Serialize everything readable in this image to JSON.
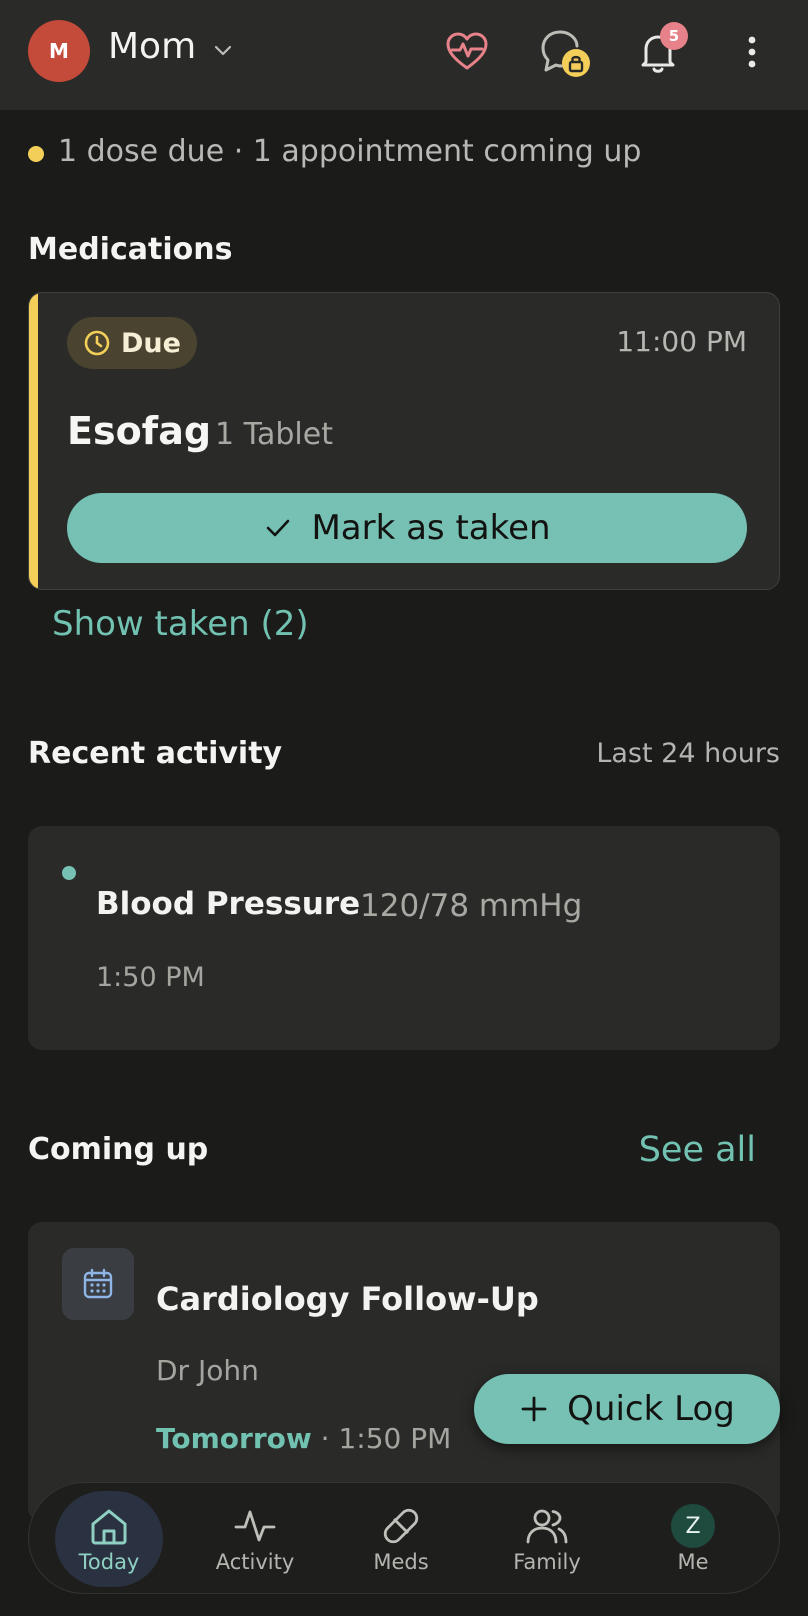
{
  "header": {
    "avatar_initial": "M",
    "profile_name": "Mom",
    "notifications_count": "5",
    "icons": [
      "heart-pulse-icon",
      "chat-lock-icon",
      "bell-icon",
      "more-vertical-icon"
    ]
  },
  "summary": {
    "text": "1 dose due · 1 appointment coming up"
  },
  "medications": {
    "title": "Medications",
    "card": {
      "status": "Due",
      "time": "11:00 PM",
      "name": "Esofag",
      "dose": "1 Tablet",
      "action_label": "Mark as taken"
    },
    "show_taken_label": "Show taken (2)"
  },
  "recent": {
    "title": "Recent activity",
    "range": "Last 24 hours",
    "items": [
      {
        "title": "Blood Pressure",
        "value": "120/78 mmHg",
        "time": "1:50 PM"
      }
    ]
  },
  "coming_up": {
    "title": "Coming up",
    "see_all": "See all",
    "items": [
      {
        "title": "Cardiology Follow-Up",
        "doctor": "Dr John",
        "day": "Tomorrow",
        "time": "· 1:50 PM"
      }
    ]
  },
  "quick_log": {
    "label": "Quick Log"
  },
  "nav": {
    "items": [
      {
        "label": "Today",
        "active": true
      },
      {
        "label": "Activity"
      },
      {
        "label": "Meds"
      },
      {
        "label": "Family"
      },
      {
        "label": "Me",
        "avatar_initial": "Z"
      }
    ]
  },
  "colors": {
    "accent": "#76c1b3",
    "due": "#f3cf5a",
    "background": "#1b1b1a",
    "card": "#2a2a29"
  }
}
